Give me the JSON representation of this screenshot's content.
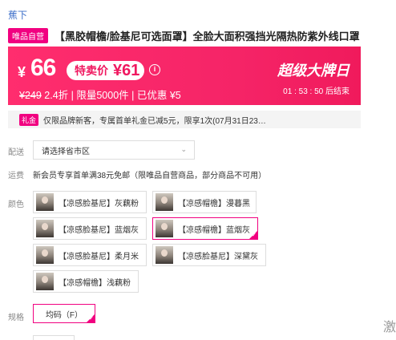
{
  "brand": "蕉下",
  "product": {
    "tag": "唯品自营",
    "title": "【黑胶帽檐/脸基尼可选面罩】全脸大面积强挡光隔热防紫外线口罩"
  },
  "price": {
    "currency": "¥",
    "main": "66",
    "special_label": "特卖价",
    "special_price": "¥61",
    "info_icon": "i",
    "original": "¥249",
    "sub_rest": " 2.4折 | 限量5000件 | 已优惠 ¥5",
    "event": "超级大牌日",
    "countdown": "01 : 53 : 50  后结束"
  },
  "coupon": {
    "tag": "礼金",
    "text": "仅限品牌新客，专属首单礼金已减5元，限享1次(07月31日23…"
  },
  "delivery": {
    "label": "配送",
    "placeholder": "请选择省市区",
    "chevron_icon": "chevron-down-icon"
  },
  "shipping": {
    "label": "运费",
    "text": "新会员专享首单满38元免邮（限唯品自营商品，部分商品不可用）"
  },
  "colors": {
    "label": "颜色",
    "items": [
      {
        "label": "【凉感脸基尼】灰藕粉",
        "selected": false
      },
      {
        "label": "【凉感帽檐】漫暮黑",
        "selected": false
      },
      {
        "label": "【凉感脸基尼】蓝烟灰",
        "selected": false
      },
      {
        "label": "【凉感帽檐】蓝烟灰",
        "selected": true
      },
      {
        "label": "【凉感脸基尼】柔月米",
        "selected": false
      },
      {
        "label": "【凉感脸基尼】深黛灰",
        "selected": false
      },
      {
        "label": "【凉感帽檐】浅藕粉",
        "selected": false
      }
    ]
  },
  "size": {
    "label": "规格",
    "value": "均码（F）"
  },
  "side_text": "激",
  "colors_theme": {
    "accent": "#f10180",
    "banner": "#f52467",
    "link": "#3d6fc9"
  }
}
